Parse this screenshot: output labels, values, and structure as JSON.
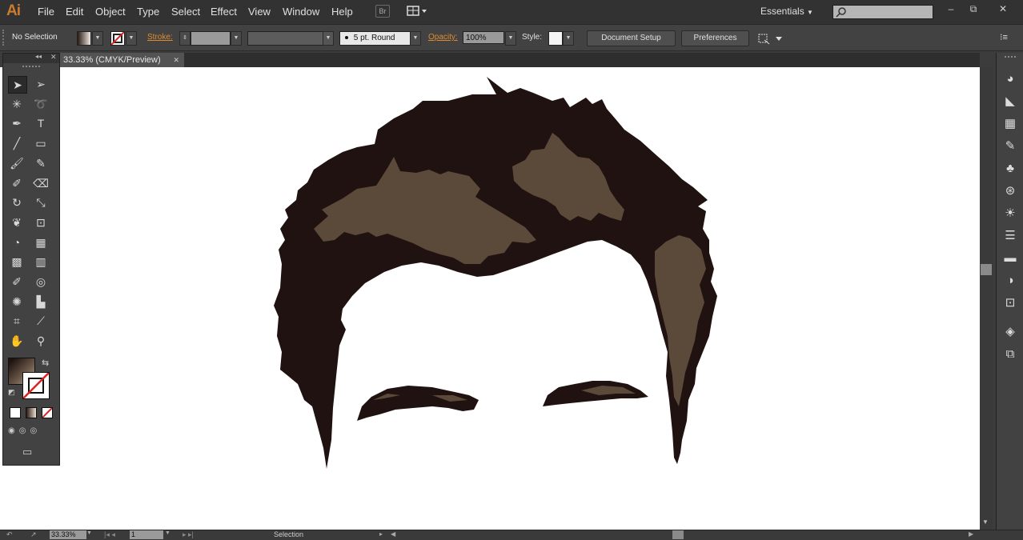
{
  "app": {
    "logo": "Ai"
  },
  "menu": [
    "File",
    "Edit",
    "Object",
    "Type",
    "Select",
    "Effect",
    "View",
    "Window",
    "Help"
  ],
  "bridge_label": "Br",
  "workspace": {
    "label": "Essentials"
  },
  "window_controls": {
    "minimize": "–",
    "restore": "⧉",
    "close": "✕"
  },
  "control_bar": {
    "selection": "No Selection",
    "stroke_label": "Stroke:",
    "brush": "5 pt. Round",
    "opacity_label": "Opacity:",
    "opacity_value": "100%",
    "style_label": "Style:",
    "document_setup": "Document Setup",
    "preferences": "Preferences"
  },
  "document": {
    "tab_title": "33.33% (CMYK/Preview)",
    "close": "✕"
  },
  "status_bar": {
    "zoom": "33.33%",
    "artboard": "1",
    "info": "Selection"
  },
  "colors": {
    "hair_dark": "#1f1210",
    "hair_highlight": "#5b4a39",
    "accent_orange": "#e08a2e"
  },
  "toolbox_icons": [
    "selection-icon",
    "direct-selection-icon",
    "magic-wand-icon",
    "lasso-icon",
    "pen-icon",
    "type-icon",
    "line-icon",
    "rectangle-icon",
    "paintbrush-icon",
    "pencil-icon",
    "blob-brush-icon",
    "eraser-icon",
    "rotate-icon",
    "scale-icon",
    "warp-icon",
    "free-transform-icon",
    "shape-builder-icon",
    "perspective-grid-icon",
    "mesh-icon",
    "gradient-icon",
    "eyedropper-icon",
    "blend-icon",
    "symbol-sprayer-icon",
    "column-graph-icon",
    "artboard-icon",
    "slice-icon",
    "hand-icon",
    "zoom-icon"
  ],
  "right_panel_icons": [
    "color-icon",
    "color-guide-icon",
    "swatches-icon",
    "brushes-icon",
    "symbols-icon",
    "graphic-styles-icon",
    "appearance-icon",
    "stroke-icon",
    "gradient-panel-icon",
    "transparency-icon",
    "align-icon",
    "layers-icon",
    "artboards-icon"
  ]
}
